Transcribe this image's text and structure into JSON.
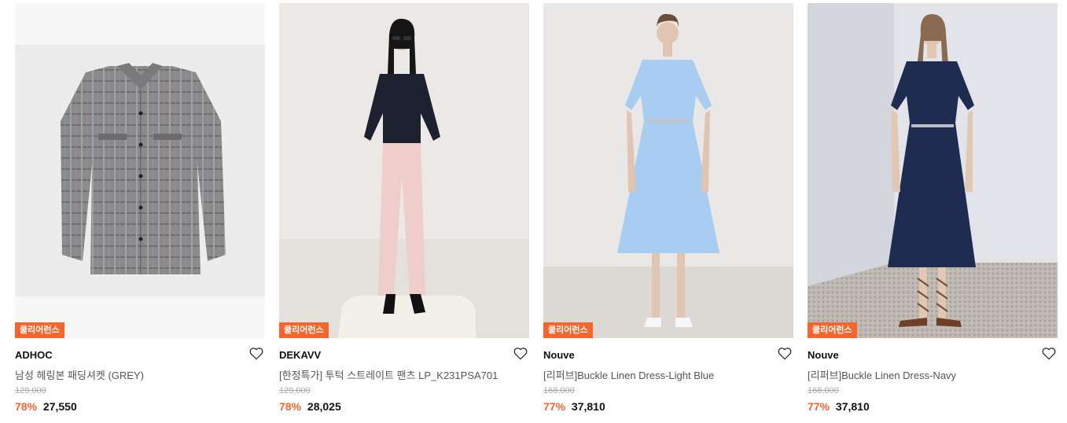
{
  "products": [
    {
      "badge": "쿨리어런스",
      "brand": "ADHOC",
      "name": "남성 헤링본 패딩셔켓 (GREY)",
      "original_price": "129,000",
      "discount": "78%",
      "price": "27,550"
    },
    {
      "badge": "쿨리어런스",
      "brand": "DEKAVV",
      "name": "[한정특가] 투턱 스트레이트 팬츠 LP_K231PSA701",
      "original_price": "129,000",
      "discount": "78%",
      "price": "28,025"
    },
    {
      "badge": "쿨리어런스",
      "brand": "Nouve",
      "name": "[리퍼브]Buckle Linen Dress-Light Blue",
      "original_price": "168,000",
      "discount": "77%",
      "price": "37,810"
    },
    {
      "badge": "쿨리어런스",
      "brand": "Nouve",
      "name": "[리퍼브]Buckle Linen Dress-Navy",
      "original_price": "168,000",
      "discount": "77%",
      "price": "37,810"
    }
  ],
  "colors": {
    "accent": "#f5662d",
    "badge_text": "#ffffff"
  },
  "icons": {
    "wishlist": "heart-outline-icon"
  }
}
